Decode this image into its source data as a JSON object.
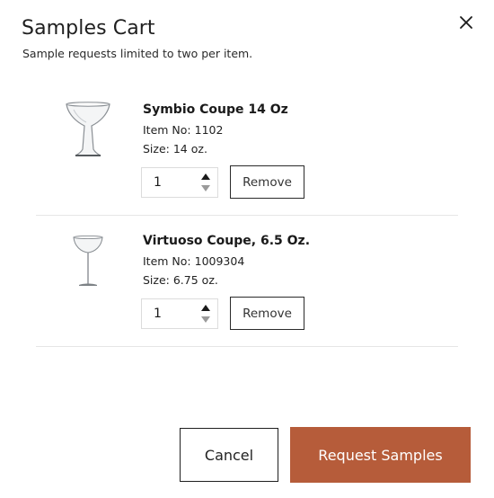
{
  "modal": {
    "title": "Samples Cart",
    "subtitle": "Sample requests limited to two per item.",
    "close_icon": "close-icon"
  },
  "items": [
    {
      "name": "Symbio Coupe 14 Oz",
      "item_no_label": "Item No:",
      "item_no": "1102",
      "size_label": "Size:",
      "size": "14 oz.",
      "quantity": "1",
      "remove_label": "Remove",
      "image_icon": "coupe-glass-icon"
    },
    {
      "name": "Virtuoso Coupe, 6.5 Oz.",
      "item_no_label": "Item No:",
      "item_no": "1009304",
      "size_label": "Size:",
      "size": "6.75 oz.",
      "quantity": "1",
      "remove_label": "Remove",
      "image_icon": "stemmed-coupe-glass-icon"
    }
  ],
  "footer": {
    "cancel_label": "Cancel",
    "request_label": "Request Samples"
  },
  "colors": {
    "accent": "#b65c3a",
    "text": "#1a1a1a",
    "divider": "#e6e6e6"
  }
}
